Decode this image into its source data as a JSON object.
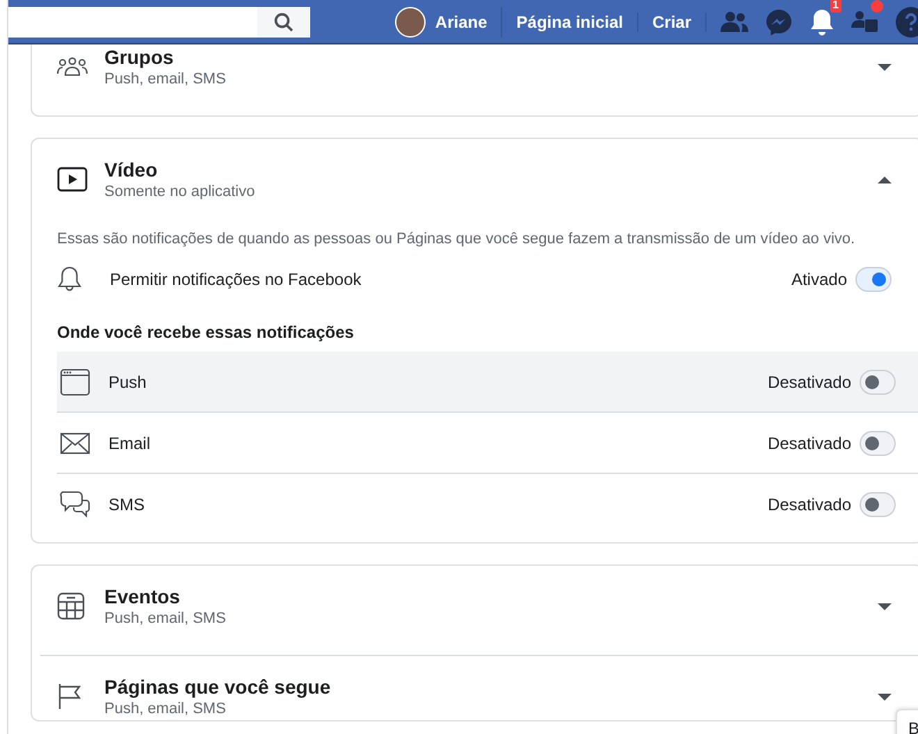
{
  "top_bar": {
    "profile_name": "Ariane",
    "links": [
      "Página inicial",
      "Criar"
    ],
    "icons": [
      {
        "kind": "friends",
        "dot": false
      },
      {
        "kind": "messenger",
        "dot": false
      },
      {
        "kind": "bell",
        "badge": "1",
        "dot": false
      },
      {
        "kind": "pages",
        "dot": true
      },
      {
        "kind": "help",
        "dot": false
      }
    ]
  },
  "sections": [
    {
      "kind": "groups",
      "title": "Grupos",
      "subtitle": "Push, email, SMS",
      "expanded": false
    },
    {
      "kind": "video",
      "title": "Vídeo",
      "subtitle": "Somente no aplicativo",
      "expanded": true,
      "description": "Essas são notificações de quando as pessoas ou Páginas que você segue fazem a transmissão de um vídeo ao vivo.",
      "master": {
        "label": "Permitir notificações no Facebook",
        "status": "Ativado",
        "on": true
      },
      "channels_heading": "Onde você recebe essas notificações",
      "channels": [
        {
          "kind": "push",
          "label": "Push",
          "status": "Desativado",
          "on": false,
          "highlighted": true
        },
        {
          "kind": "email",
          "label": "Email",
          "status": "Desativado",
          "on": false,
          "highlighted": false
        },
        {
          "kind": "sms",
          "label": "SMS",
          "status": "Desativado",
          "on": false,
          "highlighted": false
        }
      ]
    },
    {
      "kind": "events",
      "title": "Eventos",
      "subtitle": "Push, email, SMS",
      "expanded": false
    },
    {
      "kind": "pages",
      "title": "Páginas que você segue",
      "subtitle": "Push, email, SMS",
      "expanded": false
    }
  ],
  "chat_tab": {
    "label": "B"
  }
}
